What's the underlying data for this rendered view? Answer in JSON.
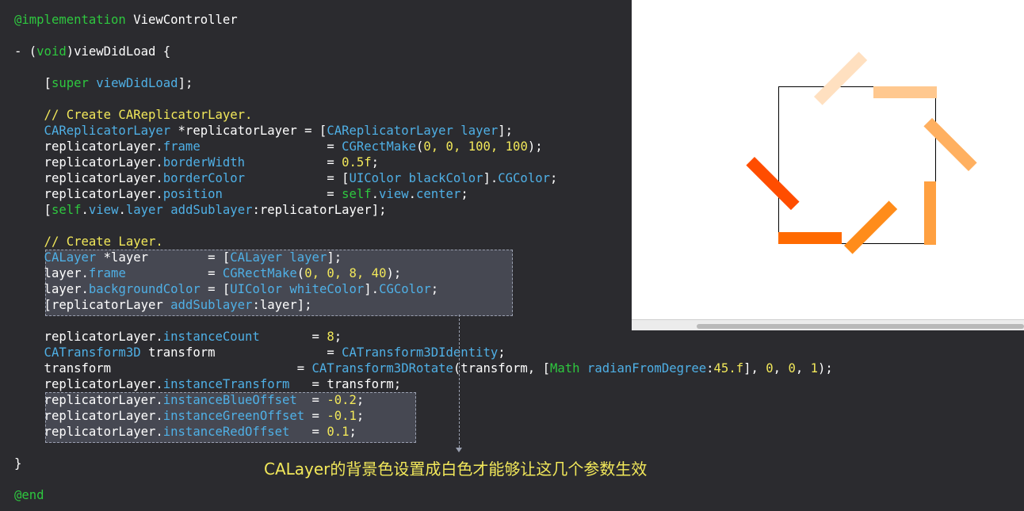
{
  "code": {
    "implementation": "@implementation",
    "class_name": " ViewController",
    "method_sig_1": "- (",
    "method_void": "void",
    "method_sig_2": ")viewDidLoad {",
    "super_open": "    [",
    "super_kw": "super",
    "super_method": " viewDidLoad",
    "super_close": "];",
    "comment_replicator": "    // Create CAReplicatorLayer.",
    "rep_decl_class": "    CAReplicatorLayer",
    "rep_decl_mid": " *replicatorLayer = [",
    "rep_decl_class2": "CAReplicatorLayer",
    "rep_decl_msg": " layer",
    "rep_decl_end": "];",
    "rep_frame_obj": "    replicatorLayer.",
    "rep_frame_prop": "frame",
    "rep_frame_eq": "                 = ",
    "rep_frame_fn": "CGRectMake",
    "rep_frame_args_open": "(",
    "rep_frame_args": "0, 0, 100, 100",
    "rep_frame_args_close": ");",
    "rep_border_obj": "    replicatorLayer.",
    "rep_border_prop": "borderWidth",
    "rep_border_eq": "           = ",
    "rep_border_val": "0.5f",
    "rep_border_end": ";",
    "rep_bcolor_obj": "    replicatorLayer.",
    "rep_bcolor_prop": "borderColor",
    "rep_bcolor_eq": "           = [",
    "rep_bcolor_cls": "UIColor",
    "rep_bcolor_msg": " blackColor",
    "rep_bcolor_mid": "].",
    "rep_bcolor_prop2": "CGColor",
    "rep_bcolor_end": ";",
    "rep_pos_obj": "    replicatorLayer.",
    "rep_pos_prop": "position",
    "rep_pos_eq": "              = ",
    "rep_pos_self": "self",
    "rep_pos_dot": ".",
    "rep_pos_view": "view",
    "rep_pos_dot2": ".",
    "rep_pos_center": "center",
    "rep_pos_end": ";",
    "add_open": "    [",
    "add_self": "self",
    "add_dot": ".",
    "add_view": "view",
    "add_dot2": ".",
    "add_layer": "layer",
    "add_msg": " addSublayer",
    "add_rest": ":replicatorLayer];",
    "comment_layer": "    // Create Layer.",
    "layer_decl_cls": "    CALayer",
    "layer_decl_mid": " *layer        = [",
    "layer_decl_cls2": "CALayer",
    "layer_decl_msg": " layer",
    "layer_decl_end": "];",
    "layer_frame_obj": "    layer.",
    "layer_frame_prop": "frame",
    "layer_frame_eq": "           = ",
    "layer_frame_fn": "CGRectMake",
    "layer_frame_open": "(",
    "layer_frame_args": "0, 0, 8, 40",
    "layer_frame_close": ");",
    "layer_bg_obj": "    layer.",
    "layer_bg_prop": "backgroundColor",
    "layer_bg_eq": " = [",
    "layer_bg_cls": "UIColor",
    "layer_bg_msg": " whiteColor",
    "layer_bg_mid": "].",
    "layer_bg_prop2": "CGColor",
    "layer_bg_end": ";",
    "layer_add_open": "    [replicatorLayer",
    "layer_add_msg": " addSublayer",
    "layer_add_rest": ":layer];",
    "count_obj": "    replicatorLayer.",
    "count_prop": "instanceCount",
    "count_eq": "       = ",
    "count_val": "8",
    "count_end": ";",
    "t_decl_cls": "    CATransform3D",
    "t_decl_mid": " transform               = ",
    "t_decl_fn": "CATransform3DIdentity",
    "t_decl_end": ";",
    "t_rot_var": "    transform                         = ",
    "t_rot_fn": "CATransform3DRotate",
    "t_rot_mid": "(transform, [",
    "t_rot_cls": "Math",
    "t_rot_msg": " radianFromDegree",
    "t_rot_colon": ":",
    "t_rot_deg": "45.f",
    "t_rot_sep": "], ",
    "t_rot_a": "0",
    "t_rot_c1": ", ",
    "t_rot_b": "0",
    "t_rot_c2": ", ",
    "t_rot_c": "1",
    "t_rot_end": ");",
    "it_obj": "    replicatorLayer.",
    "it_prop": "instanceTransform",
    "it_rest": "   = transform;",
    "blue_obj": "    replicatorLayer.",
    "blue_prop": "instanceBlueOffset",
    "blue_eq": "  = ",
    "blue_val": "-0.2",
    "blue_end": ";",
    "green_obj": "    replicatorLayer.",
    "green_prop": "instanceGreenOffset",
    "green_eq": " = ",
    "green_val": "-0.1",
    "green_end": ";",
    "red_obj": "    replicatorLayer.",
    "red_prop": "instanceRedOffset",
    "red_eq": "   = ",
    "red_val": "0.1",
    "red_end": ";",
    "close_brace": "}",
    "end": "@end"
  },
  "annotation": {
    "text": "CALayer的背景色设置成白色才能够让这几个参数生效",
    "color": "#f2e85a"
  },
  "simulator": {
    "background": "#ffffff",
    "instance_count": 8,
    "instance_colors": [
      "#ff6a00",
      "#ff8c1a",
      "#ffa040",
      "#ffb060",
      "#ffc88f",
      "#ffe0c0",
      "#ff4d00",
      "#f06010"
    ]
  },
  "colors": {
    "editor_background": "#2b2b2f",
    "keyword": "#2ec73f",
    "class": "#4fb0e6",
    "number": "#f2e85a",
    "comment": "#f2e85a"
  }
}
